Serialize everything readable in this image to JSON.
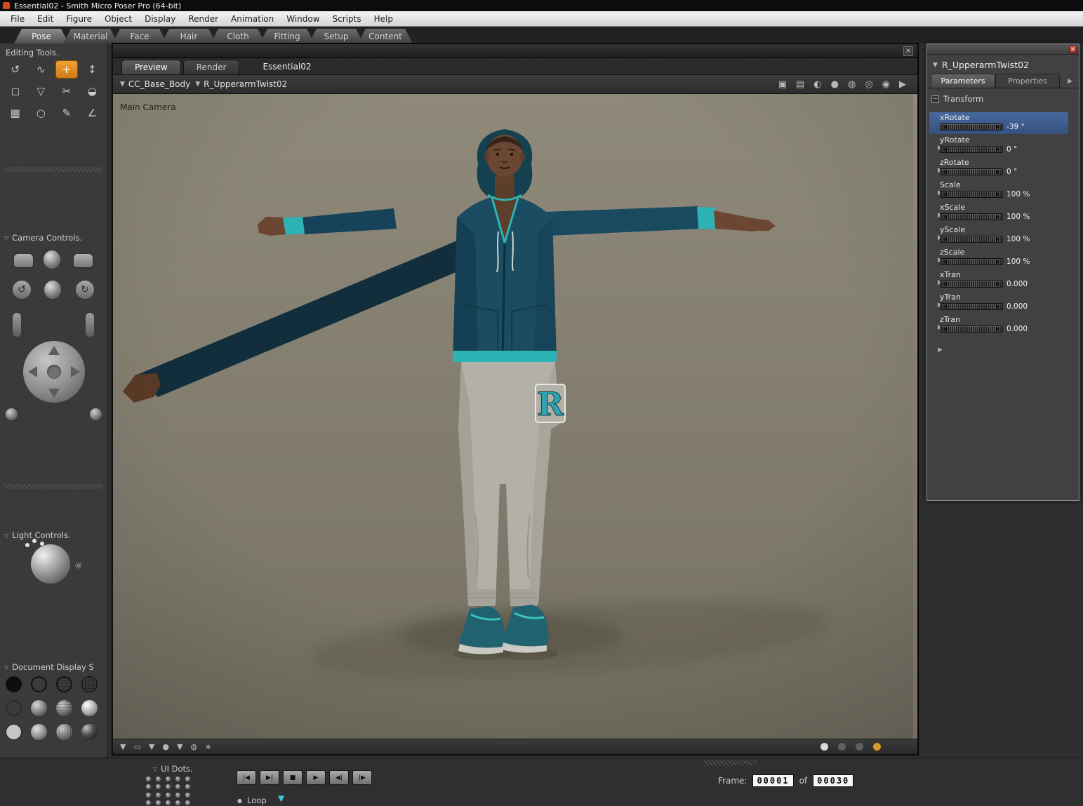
{
  "window": {
    "title": "Essential02 - Smith Micro Poser Pro  (64-bit)"
  },
  "menu": {
    "items": [
      "File",
      "Edit",
      "Figure",
      "Object",
      "Display",
      "Render",
      "Animation",
      "Window",
      "Scripts",
      "Help"
    ]
  },
  "room_tabs": {
    "items": [
      "Pose",
      "Material",
      "Face",
      "Hair",
      "Cloth",
      "Fitting",
      "Setup",
      "Content"
    ]
  },
  "sidebar": {
    "editing_tools": "Editing Tools.",
    "camera_controls": "Camera Controls.",
    "light_controls": "Light Controls.",
    "document_display": "Document Display S",
    "ui_dots": "UI Dots."
  },
  "viewport": {
    "tab_preview": "Preview",
    "tab_render": "Render",
    "document_title": "Essential02",
    "figure_selector": "CC_Base_Body",
    "actor_selector": "R_UpperarmTwist02",
    "camera_label": "Main Camera"
  },
  "parameters": {
    "title": "R_UpperarmTwist02",
    "tab_parameters": "Parameters",
    "tab_properties": "Properties",
    "section": "Transform",
    "dials": [
      {
        "label": "xRotate",
        "value": "-39 °"
      },
      {
        "label": "yRotate",
        "value": "0 °"
      },
      {
        "label": "zRotate",
        "value": "0 °"
      },
      {
        "label": "Scale",
        "value": "100 %"
      },
      {
        "label": "xScale",
        "value": "100 %"
      },
      {
        "label": "yScale",
        "value": "100 %"
      },
      {
        "label": "zScale",
        "value": "100 %"
      },
      {
        "label": "xTran",
        "value": "0.000"
      },
      {
        "label": "yTran",
        "value": "0.000"
      },
      {
        "label": "zTran",
        "value": "0.000"
      }
    ]
  },
  "anim": {
    "frame_label": "Frame:",
    "frame_current": "00001",
    "of_label": "of",
    "frame_total": "00030",
    "loop_label": "Loop"
  },
  "icons": {
    "dropdown": "▼",
    "triangle_open": "▽",
    "arrow_right": "▶",
    "close": "×",
    "collapse": "−",
    "sun": "☼",
    "loop_bullet": "●",
    "scrub_triangle": "▼",
    "tools": [
      "↺",
      "∿",
      "+",
      "↕",
      "◻",
      "▽",
      "✂",
      "◒",
      "▦",
      "○",
      "✎",
      "∠"
    ],
    "vp_toolbar": [
      "▣",
      "▤",
      "◐",
      "●",
      "◍",
      "◎",
      "◉",
      "▶"
    ],
    "vp_bottom": [
      "▼",
      "▭",
      "▼",
      "●",
      "▼",
      "◍",
      "∗"
    ],
    "transport": [
      "|◀",
      "▶|",
      "■",
      "▶",
      "◀|",
      "|▶"
    ]
  },
  "colors": {
    "accent_orange": "#e0861a",
    "selection_blue": "#3c5e90",
    "trim_teal": "#2db3b3",
    "viewport_bg": "#86816f"
  }
}
